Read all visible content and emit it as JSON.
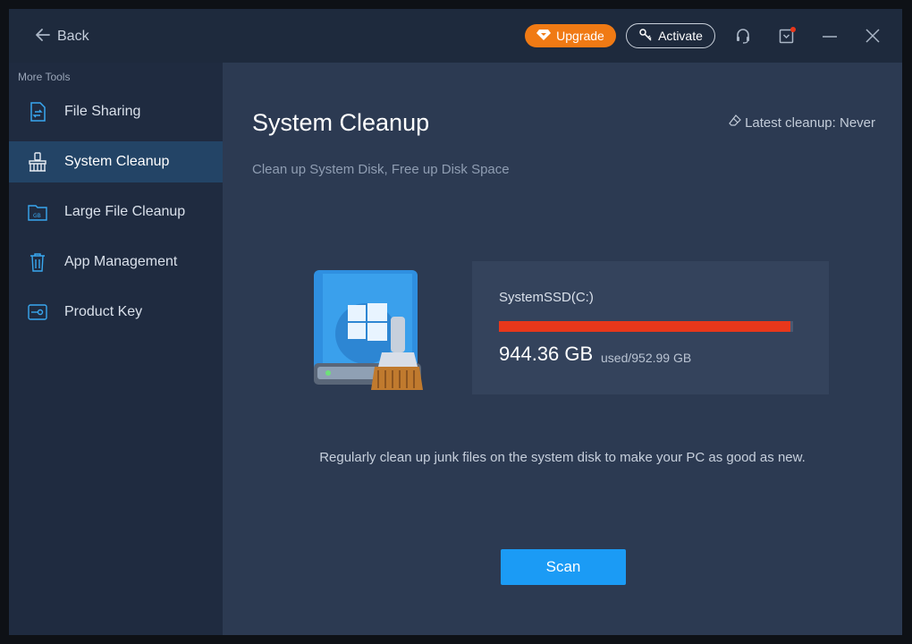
{
  "titlebar": {
    "back_label": "Back",
    "upgrade_label": "Upgrade",
    "activate_label": "Activate",
    "icons": [
      "headset-icon",
      "download-icon",
      "minimize-icon",
      "close-icon"
    ]
  },
  "sidebar": {
    "section_title": "More Tools",
    "items": [
      {
        "label": "File Sharing",
        "icon": "file-sharing-icon",
        "active": false
      },
      {
        "label": "System Cleanup",
        "icon": "broom-icon",
        "active": true
      },
      {
        "label": "Large File Cleanup",
        "icon": "gb-folder-icon",
        "active": false
      },
      {
        "label": "App Management",
        "icon": "trash-icon",
        "active": false
      },
      {
        "label": "Product Key",
        "icon": "key-icon",
        "active": false
      }
    ]
  },
  "main": {
    "title": "System Cleanup",
    "subtitle": "Clean up System Disk, Free up Disk Space",
    "latest_cleanup": "Latest cleanup: Never",
    "disk": {
      "name": "SystemSSD(C:)",
      "used": "944.36 GB",
      "total_label": "used/952.99 GB",
      "used_fraction": 0.991
    },
    "hint": "Regularly clean up junk files on the system disk to make your PC as good as new.",
    "scan_label": "Scan"
  },
  "colors": {
    "accent": "#1b9bf5",
    "upgrade": "#f07a14",
    "usage_bar": "#e8371b",
    "sidebar_active": "#234466"
  }
}
